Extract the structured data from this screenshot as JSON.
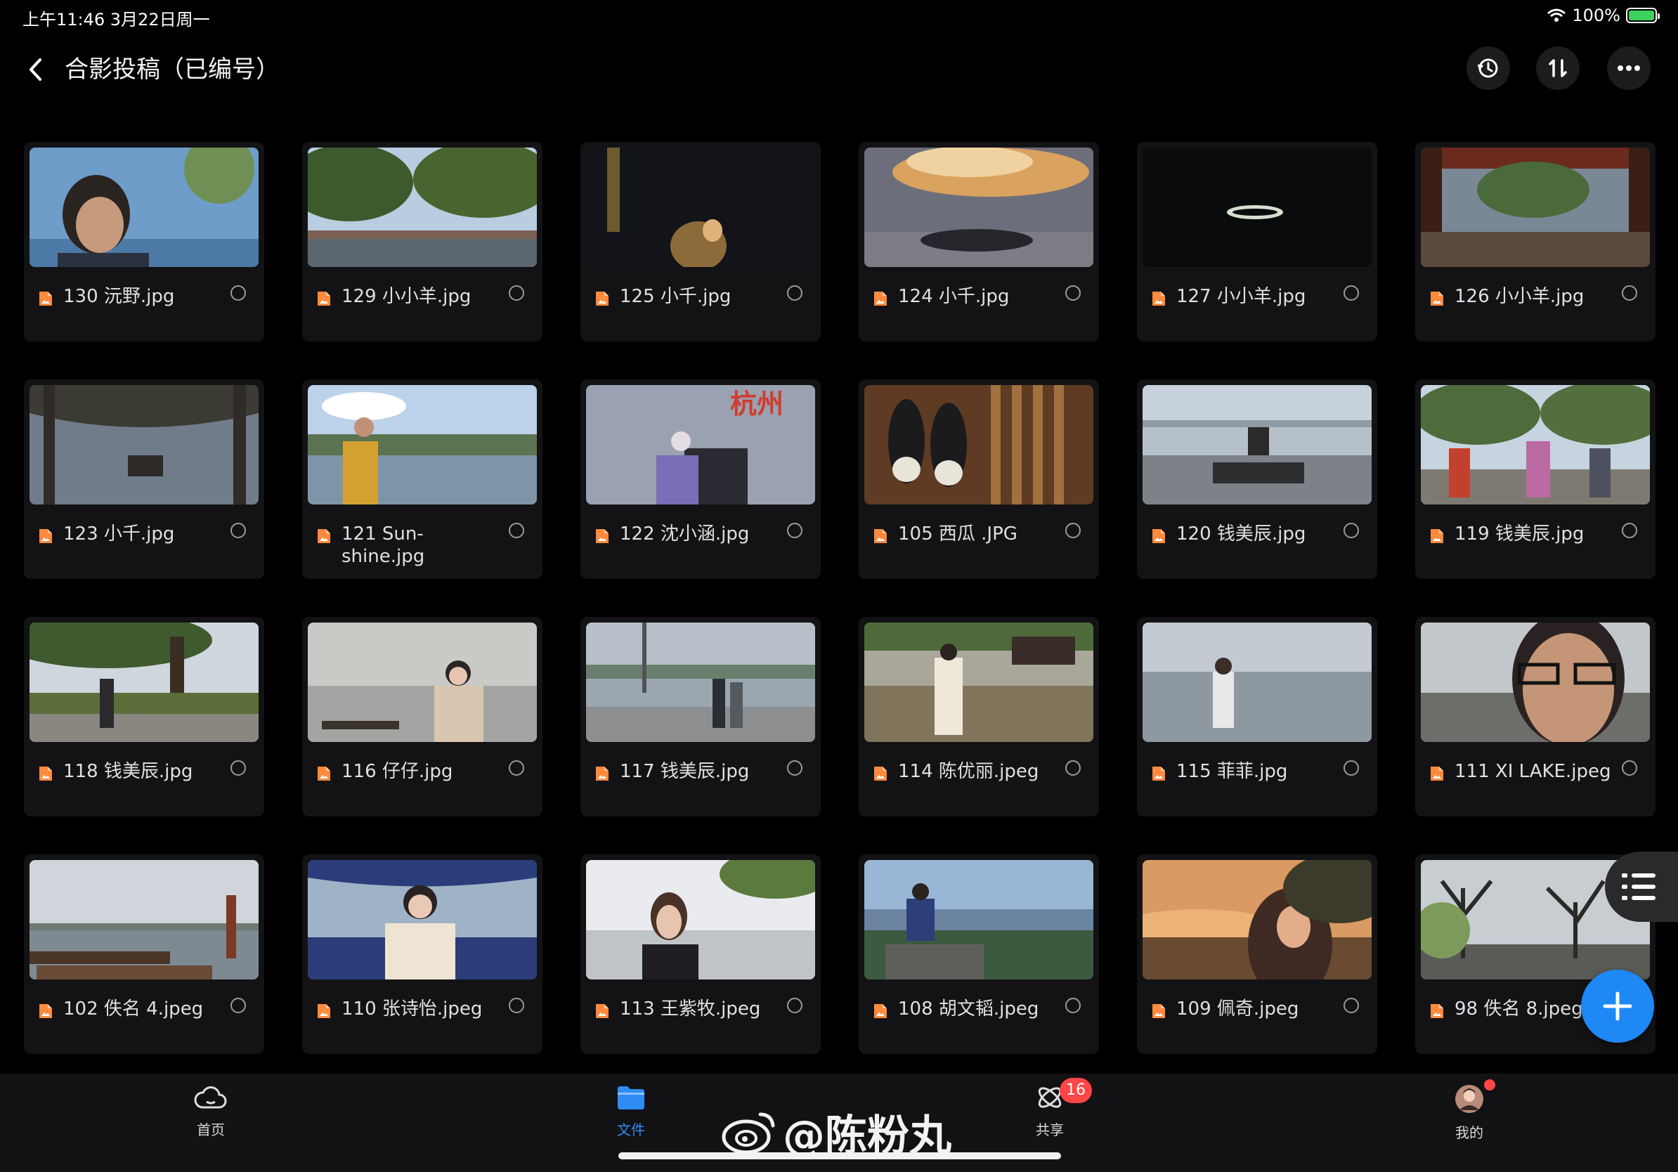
{
  "status": {
    "time": "上午11:46  3月22日周一",
    "battery": "100%",
    "battery_level": 1.0
  },
  "header": {
    "title": "合影投稿（已编号）"
  },
  "colors": {
    "accent": "#2f8cf5",
    "file_icon": "#ff8a3d",
    "badge": "#ff4545"
  },
  "files": [
    {
      "name": "130 沅野.jpg",
      "scene": "portrait-blue"
    },
    {
      "name": "129 小小羊.jpg",
      "scene": "trees"
    },
    {
      "name": "125 小千.jpg",
      "scene": "night-couple"
    },
    {
      "name": "124 小千.jpg",
      "scene": "sunset-cloud"
    },
    {
      "name": "127 小小羊.jpg",
      "scene": "night-dark"
    },
    {
      "name": "126 小小羊.jpg",
      "scene": "pavilion"
    },
    {
      "name": "123 小千.jpg",
      "scene": "willow"
    },
    {
      "name": "121 Sun-\nshine.jpg",
      "scene": "lake-person"
    },
    {
      "name": "122 沈小涵.jpg",
      "scene": "hangzhou"
    },
    {
      "name": "105 西瓜 .JPG",
      "scene": "shoes"
    },
    {
      "name": "120 钱美辰.jpg",
      "scene": "bench"
    },
    {
      "name": "119 钱美辰.jpg",
      "scene": "dance"
    },
    {
      "name": "118 钱美辰.jpg",
      "scene": "tree-old"
    },
    {
      "name": "116 仔仔.jpg",
      "scene": "girl-boat"
    },
    {
      "name": "117 钱美辰.jpg",
      "scene": "walkers"
    },
    {
      "name": "114 陈优丽.jpeg",
      "scene": "girl-garden"
    },
    {
      "name": "115 菲菲.jpg",
      "scene": "grey-lake"
    },
    {
      "name": "111 XI LAKE.jpeg",
      "scene": "selfie"
    },
    {
      "name": "102 佚名 4.jpeg",
      "scene": "boats"
    },
    {
      "name": "110 张诗怡.jpeg",
      "scene": "boat-girl"
    },
    {
      "name": "113 王紫牧.jpeg",
      "scene": "girl-white"
    },
    {
      "name": "108 胡文韬.jpeg",
      "scene": "hill-view"
    },
    {
      "name": "109 佩奇.jpeg",
      "scene": "golden"
    },
    {
      "name": "98 佚名 8.jpeg",
      "scene": "bare-trees"
    }
  ],
  "nav": {
    "home": "首页",
    "files": "文件",
    "share": "共享",
    "share_badge": "16",
    "me": "我的"
  },
  "watermark": "@陈粉丸"
}
